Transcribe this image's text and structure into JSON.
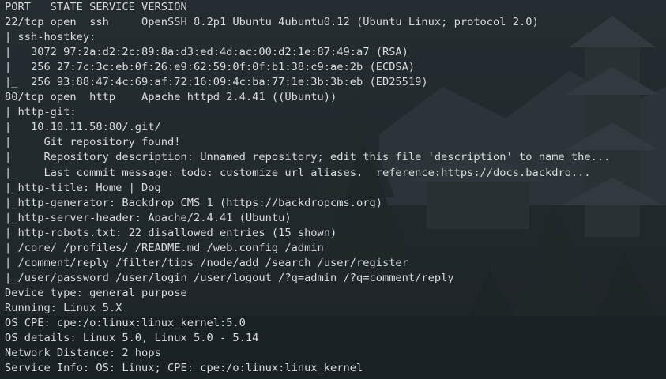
{
  "terminal": {
    "lines": [
      "PORT   STATE SERVICE VERSION",
      "22/tcp open  ssh     OpenSSH 8.2p1 Ubuntu 4ubuntu0.12 (Ubuntu Linux; protocol 2.0)",
      "| ssh-hostkey: ",
      "|   3072 97:2a:d2:2c:89:8a:d3:ed:4d:ac:00:d2:1e:87:49:a7 (RSA)",
      "|   256 27:7c:3c:eb:0f:26:e9:62:59:0f:0f:b1:38:c9:ae:2b (ECDSA)",
      "|_  256 93:88:47:4c:69:af:72:16:09:4c:ba:77:1e:3b:3b:eb (ED25519)",
      "80/tcp open  http    Apache httpd 2.4.41 ((Ubuntu))",
      "| http-git: ",
      "|   10.10.11.58:80/.git/",
      "|     Git repository found!",
      "|     Repository description: Unnamed repository; edit this file 'description' to name the...",
      "|_    Last commit message: todo: customize url aliases.  reference:https://docs.backdro...",
      "|_http-title: Home | Dog",
      "|_http-generator: Backdrop CMS 1 (https://backdropcms.org)",
      "|_http-server-header: Apache/2.4.41 (Ubuntu)",
      "| http-robots.txt: 22 disallowed entries (15 shown)",
      "| /core/ /profiles/ /README.md /web.config /admin ",
      "| /comment/reply /filter/tips /node/add /search /user/register ",
      "|_/user/password /user/login /user/logout /?q=admin /?q=comment/reply",
      "Device type: general purpose",
      "Running: Linux 5.X",
      "OS CPE: cpe:/o:linux:linux_kernel:5.0",
      "OS details: Linux 5.0, Linux 5.0 - 5.14",
      "Network Distance: 2 hops",
      "Service Info: OS: Linux; CPE: cpe:/o:linux:linux_kernel"
    ]
  },
  "colors": {
    "text": "#d8dbdc",
    "background": "#1d2529"
  }
}
